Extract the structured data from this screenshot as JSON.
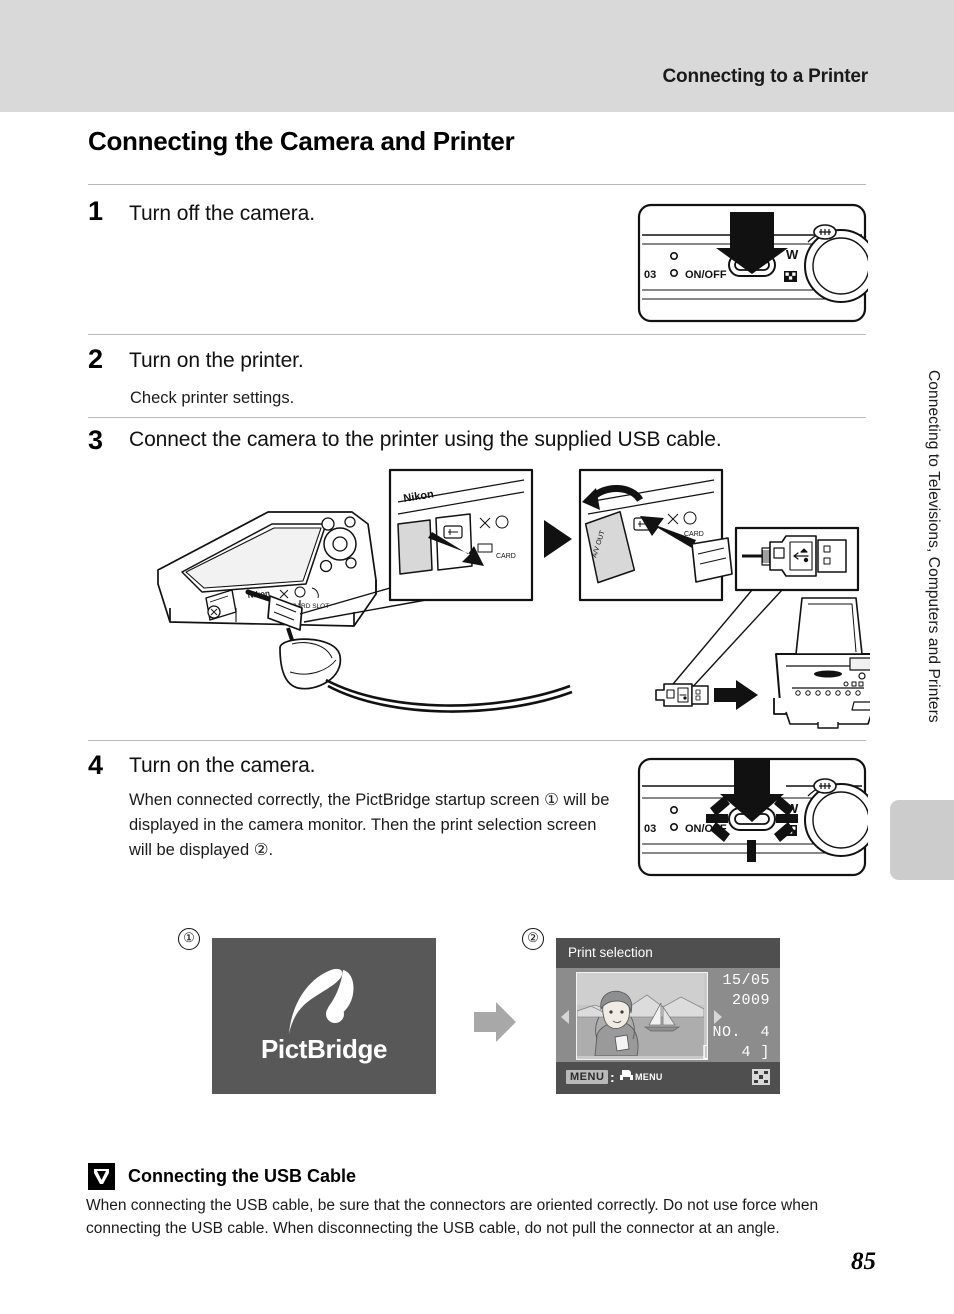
{
  "header": {
    "running_head": "Connecting to a Printer"
  },
  "page_title": "Connecting the Camera and Printer",
  "side_tab": {
    "label": "Connecting to Televisions, Computers and Printers"
  },
  "steps": [
    {
      "number": "1",
      "heading": "Turn off the camera.",
      "body": ""
    },
    {
      "number": "2",
      "heading": "Turn on the printer.",
      "body": "Check printer settings."
    },
    {
      "number": "3",
      "heading": "Connect the camera to the printer using the supplied USB cable.",
      "body": ""
    },
    {
      "number": "4",
      "heading": "Turn on the camera.",
      "body": "When connected correctly, the PictBridge startup screen ① will be displayed in the camera monitor. Then the print selection screen will be displayed ②."
    }
  ],
  "camera_illustration": {
    "model_text": "03",
    "power_label": "ON/OFF",
    "wide_label": "W",
    "tele_icon": "tele-zoom-icon",
    "thumbnail_icon": "thumbnail-playback-icon",
    "arrow_icon": "down-arrow-icon",
    "blink_icon": "power-lamp-blink-icon"
  },
  "diagram3": {
    "brand_label": "Nikon",
    "card_label": "CARD",
    "av_label": "A/V",
    "usb_icon": "usb-connector-icon",
    "printer_icon": "inkjet-printer-icon",
    "camera_icon": "compact-camera-icon",
    "insert_arrow_icon": "insert-arrow-icon",
    "open_cover_arrow_icon": "open-cover-arrow-icon"
  },
  "screens": {
    "marker_1": "①",
    "marker_2": "②",
    "pictbridge": {
      "wordmark": "PictBridge",
      "logo_icon": "pictbridge-logo-icon",
      "background": "#585858"
    },
    "flow_arrow_icon": "right-arrow-icon",
    "print_selection": {
      "title": "Print selection",
      "date_line1": "15/05",
      "date_line2": "2009",
      "number_label": "NO.",
      "number_value": "4",
      "count_open": "[",
      "count_value": "4",
      "count_close": "]",
      "menu_badge": "MENU",
      "menu_separator": ":",
      "menu_target": "MENU",
      "print_menu_icon": "print-menu-icon",
      "thumbnail_icon": "thumbnail-grid-icon",
      "left_caret_icon": "caret-left-icon",
      "right_caret_icon": "caret-right-icon",
      "photo_icon": "portrait-sailboat-photo-icon"
    }
  },
  "note": {
    "icon": "caution-checkmark-icon",
    "title": "Connecting the USB Cable",
    "text": "When connecting the USB cable, be sure that the connectors are oriented correctly. Do not use force when connecting the USB cable. When disconnecting the USB cable, do not pull the connector at an angle."
  },
  "page_number": "85",
  "colors": {
    "header_band": "#d9d9d9",
    "side_tab": "#cccccc",
    "divider": "#b8b8b8",
    "screen_dark": "#4f4f4f",
    "screen_mid": "#8c8c8c"
  }
}
